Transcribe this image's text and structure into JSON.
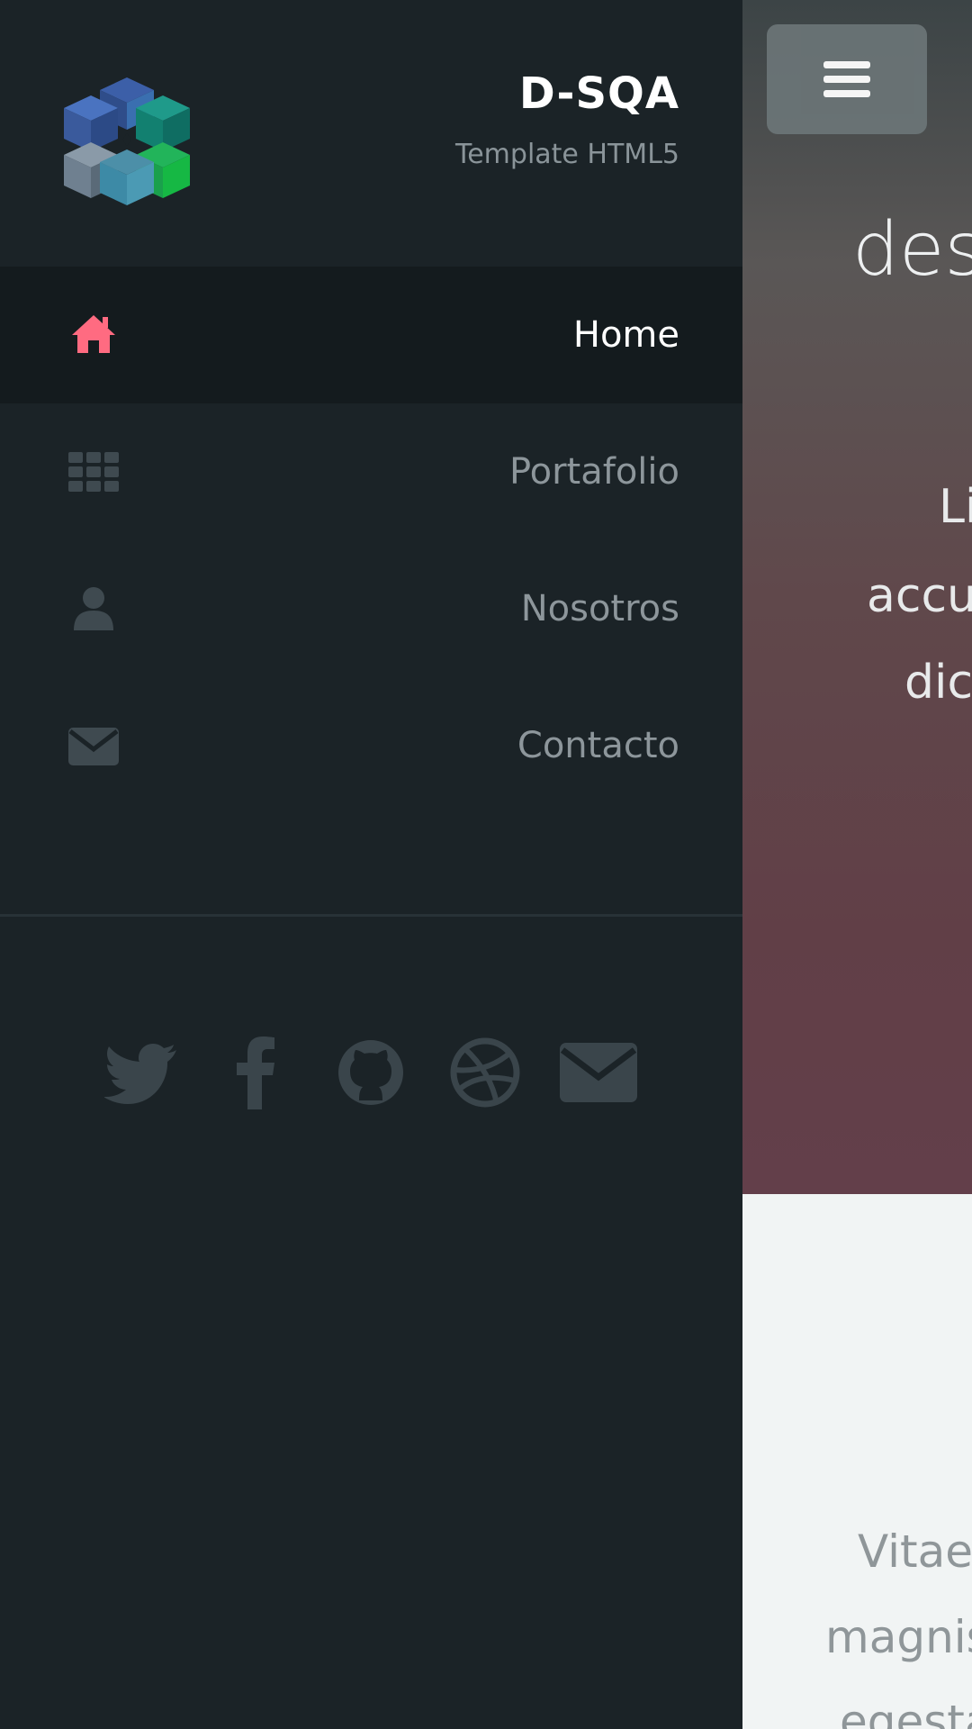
{
  "brand": {
    "title": "D-SQA",
    "subtitle": "Template HTML5"
  },
  "nav": {
    "items": [
      {
        "label": "Home",
        "icon": "home-icon",
        "active": true
      },
      {
        "label": "Portafolio",
        "icon": "grid-icon",
        "active": false
      },
      {
        "label": "Nosotros",
        "icon": "user-icon",
        "active": false
      },
      {
        "label": "Contacto",
        "icon": "envelope-icon",
        "active": false
      }
    ]
  },
  "social": [
    "twitter-icon",
    "facebook-icon",
    "github-icon",
    "dribbble-icon",
    "envelope-icon"
  ],
  "hero": {
    "title_fragment": "desa",
    "lines": [
      "Li",
      "accur",
      "dict"
    ]
  },
  "section2": {
    "lines": [
      "Vitae",
      "magnis",
      "egesta"
    ]
  },
  "colors": {
    "accent": "#ff6b81",
    "sidebar_bg": "#1b2327",
    "active_bg": "#141b1e",
    "icon_muted": "#3f4a50"
  }
}
